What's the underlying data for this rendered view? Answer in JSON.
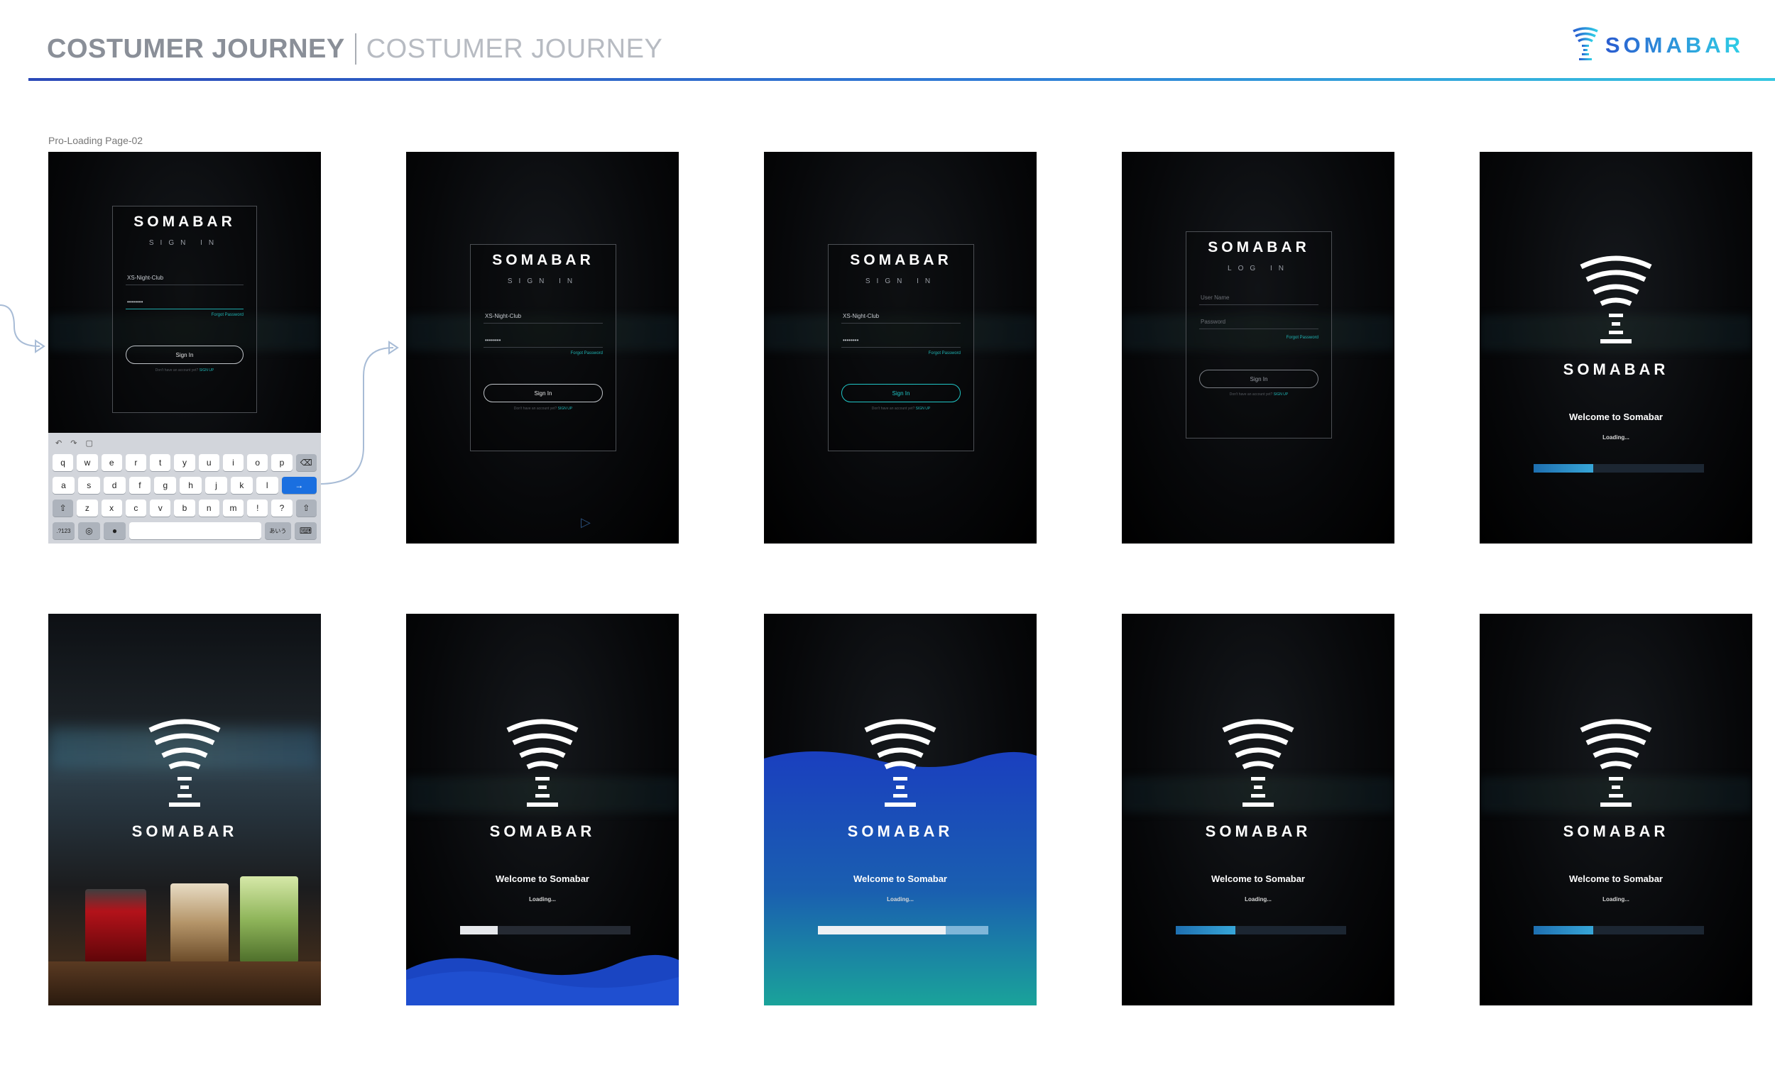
{
  "header": {
    "title_bold": "COSTUMER JOURNEY",
    "title_light": "COSTUMER JOURNEY",
    "logo_text": "SOMABAR",
    "accent_start": "#2b49b8",
    "accent_end": "#35c7e0"
  },
  "frame_caption": "Pro-Loading Page-02",
  "brand": "SOMABAR",
  "signin": {
    "subtitle": "SIGN IN",
    "username": "XS-Night-Club",
    "password": "••••••••",
    "forgot": "Forgot Password",
    "button": "Sign In",
    "signup_prompt": "Don't have an account yet?",
    "signup_link": "SIGN UP"
  },
  "login": {
    "subtitle": "LOG IN",
    "username_placeholder": "User Name",
    "password_placeholder": "Password",
    "forgot": "Forgot Password",
    "button": "Sign In"
  },
  "keyboard": {
    "row1": [
      "q",
      "w",
      "e",
      "r",
      "t",
      "y",
      "u",
      "i",
      "o",
      "p"
    ],
    "row2": [
      "a",
      "s",
      "d",
      "f",
      "g",
      "h",
      "j",
      "k",
      "l"
    ],
    "row3": [
      "z",
      "x",
      "c",
      "v",
      "b",
      "n",
      "m",
      "!",
      "?"
    ],
    "bottom_left": ".?123",
    "bottom_right": "あいう"
  },
  "loading": {
    "welcome": "Welcome to Somabar",
    "text": "Loading..."
  },
  "progress_values": {
    "screen5": 0.35,
    "screen7": 0.22,
    "screen8": 0.75,
    "screen9": 0.35,
    "screen10": 0.35
  },
  "colors": {
    "teal": "#1fb3b3",
    "progress_blue": "#2f7fd0",
    "wave_blue": "#1a45c2",
    "wave_teal": "#1aa39a"
  }
}
